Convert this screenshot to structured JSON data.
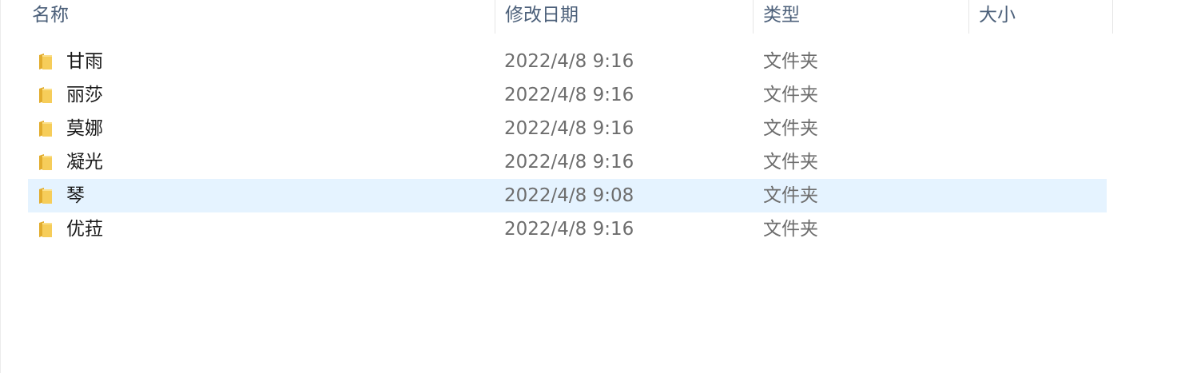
{
  "columns": {
    "name": "名称",
    "date_modified": "修改日期",
    "type": "类型",
    "size": "大小"
  },
  "colors": {
    "folder": "#f6cd5a",
    "folder_dark": "#e2ac2d",
    "selected_row": "#e5f3ff",
    "header_text": "#4c607a"
  },
  "files": [
    {
      "name": "甘雨",
      "date": "2022/4/8 9:16",
      "type": "文件夹",
      "icon": "folder-icon"
    },
    {
      "name": "丽莎",
      "date": "2022/4/8 9:16",
      "type": "文件夹",
      "icon": "folder-icon"
    },
    {
      "name": "莫娜",
      "date": "2022/4/8 9:16",
      "type": "文件夹",
      "icon": "folder-icon"
    },
    {
      "name": "凝光",
      "date": "2022/4/8 9:16",
      "type": "文件夹",
      "icon": "folder-icon"
    },
    {
      "name": "琴",
      "date": "2022/4/8 9:08",
      "type": "文件夹",
      "icon": "folder-icon"
    },
    {
      "name": "优菈",
      "date": "2022/4/8 9:16",
      "type": "文件夹",
      "icon": "folder-icon"
    }
  ]
}
